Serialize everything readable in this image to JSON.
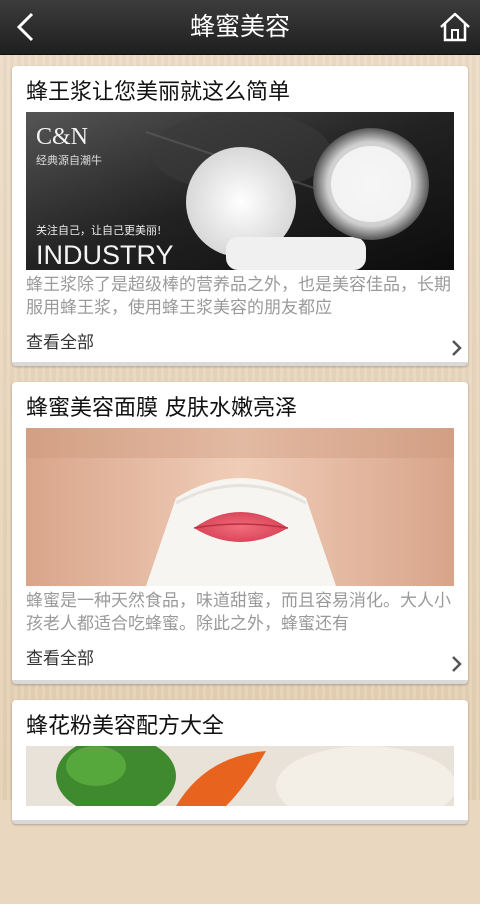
{
  "header": {
    "title": "蜂蜜美容",
    "back_icon": "back-arrow-icon",
    "home_icon": "home-icon"
  },
  "articles": [
    {
      "title": "蜂王浆让您美丽就这么简单",
      "image": {
        "brand": "C&N",
        "slogan": "经典源自潮牛",
        "tagline": "关注自己，让自己更美丽!",
        "word": "INDUSTRY"
      },
      "description": "蜂王浆除了是超级棒的营养品之外，也是美容佳品，长期服用蜂王浆，使用蜂王浆美容的朋友都应",
      "view_all": "查看全部"
    },
    {
      "title": "蜂蜜美容面膜 皮肤水嫩亮泽",
      "description": "蜂蜜是一种天然食品，味道甜蜜，而且容易消化。大人小孩老人都适合吃蜂蜜。除此之外，蜂蜜还有",
      "view_all": "查看全部"
    },
    {
      "title": "蜂花粉美容配方大全"
    }
  ],
  "colors": {
    "topbar": "#2b2b2b",
    "background": "#e9d7bf",
    "card": "#ffffff",
    "description_text": "#9a9a9a"
  }
}
